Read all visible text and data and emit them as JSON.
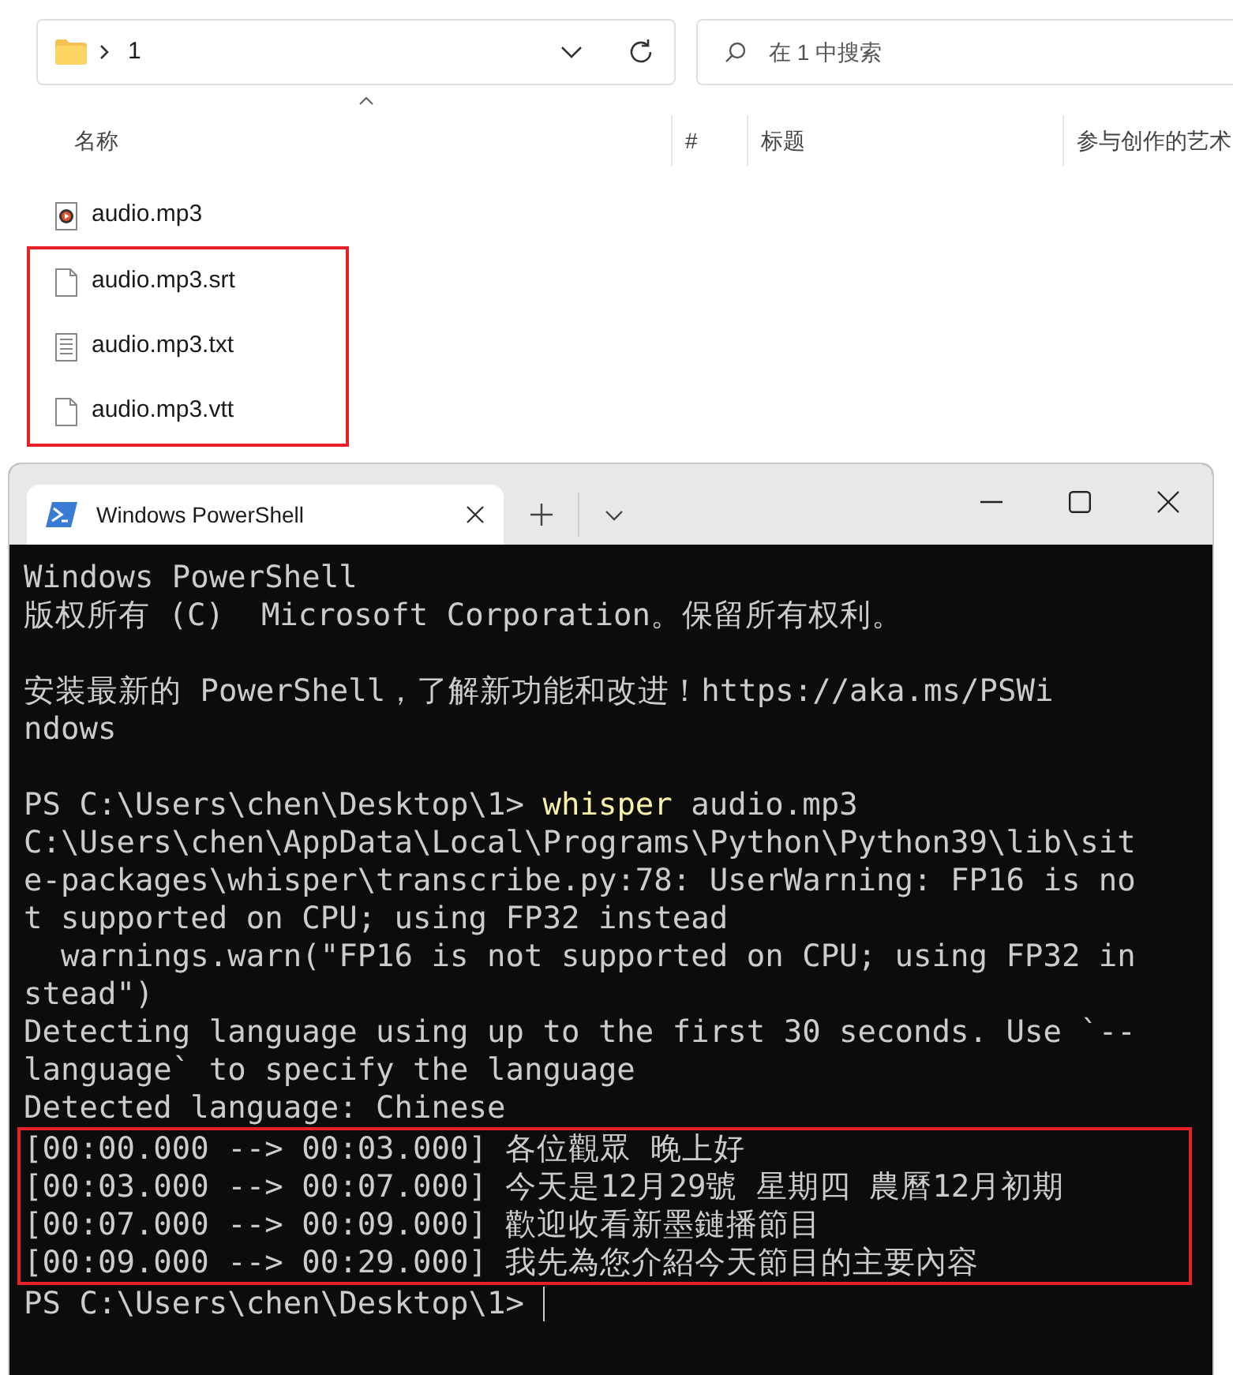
{
  "explorer": {
    "address": {
      "path": "1"
    },
    "search": {
      "placeholder": "在 1 中搜索"
    },
    "columns": [
      {
        "label": "名称",
        "sorted": true
      },
      {
        "label": "#",
        "sorted": false
      },
      {
        "label": "标题",
        "sorted": false
      },
      {
        "label": "参与创作的艺术",
        "sorted": false
      }
    ],
    "files": [
      {
        "name": "audio.mp3",
        "kind": "audio",
        "highlighted": false
      },
      {
        "name": "audio.mp3.srt",
        "kind": "blank",
        "highlighted": true
      },
      {
        "name": "audio.mp3.txt",
        "kind": "text",
        "highlighted": true
      },
      {
        "name": "audio.mp3.vtt",
        "kind": "blank",
        "highlighted": true
      }
    ]
  },
  "terminal": {
    "tab": {
      "title": "Windows PowerShell"
    },
    "lines": [
      {
        "kind": "text",
        "text": "Windows PowerShell",
        "highlighted": false
      },
      {
        "kind": "text",
        "text": "版权所有 (C)  Microsoft Corporation。保留所有权利。",
        "highlighted": false
      },
      {
        "kind": "blank",
        "highlighted": false
      },
      {
        "kind": "text",
        "text": "安装最新的 PowerShell，了解新功能和改进！https://aka.ms/PSWi",
        "highlighted": false
      },
      {
        "kind": "text",
        "text": "ndows",
        "highlighted": false
      },
      {
        "kind": "blank",
        "highlighted": false
      },
      {
        "kind": "prompt",
        "prompt": "PS C:\\Users\\chen\\Desktop\\1> ",
        "command": "whisper",
        "args": " audio.mp3",
        "highlighted": false
      },
      {
        "kind": "text",
        "text": "C:\\Users\\chen\\AppData\\Local\\Programs\\Python\\Python39\\lib\\sit",
        "highlighted": false
      },
      {
        "kind": "text",
        "text": "e-packages\\whisper\\transcribe.py:78: UserWarning: FP16 is no",
        "highlighted": false
      },
      {
        "kind": "text",
        "text": "t supported on CPU; using FP32 instead",
        "highlighted": false
      },
      {
        "kind": "text",
        "text": "  warnings.warn(\"FP16 is not supported on CPU; using FP32 in",
        "highlighted": false
      },
      {
        "kind": "text",
        "text": "stead\")",
        "highlighted": false
      },
      {
        "kind": "text",
        "text": "Detecting language using up to the first 30 seconds. Use `--",
        "highlighted": false
      },
      {
        "kind": "text",
        "text": "language` to specify the language",
        "highlighted": false
      },
      {
        "kind": "text",
        "text": "Detected language: Chinese",
        "highlighted": false
      },
      {
        "kind": "text",
        "text": "[00:00.000 --> 00:03.000] 各位觀眾 晚上好",
        "highlighted": true
      },
      {
        "kind": "text",
        "text": "[00:03.000 --> 00:07.000] 今天是12月29號 星期四 農曆12月初期",
        "highlighted": true
      },
      {
        "kind": "text",
        "text": "[00:07.000 --> 00:09.000] 歡迎收看新墨鏈播節目",
        "highlighted": true
      },
      {
        "kind": "text",
        "text": "[00:09.000 --> 00:29.000] 我先為您介紹今天節目的主要內容",
        "highlighted": true
      },
      {
        "kind": "prompt",
        "prompt": "PS C:\\Users\\chen\\Desktop\\1> ",
        "highlighted": false,
        "cursor": true
      }
    ]
  }
}
